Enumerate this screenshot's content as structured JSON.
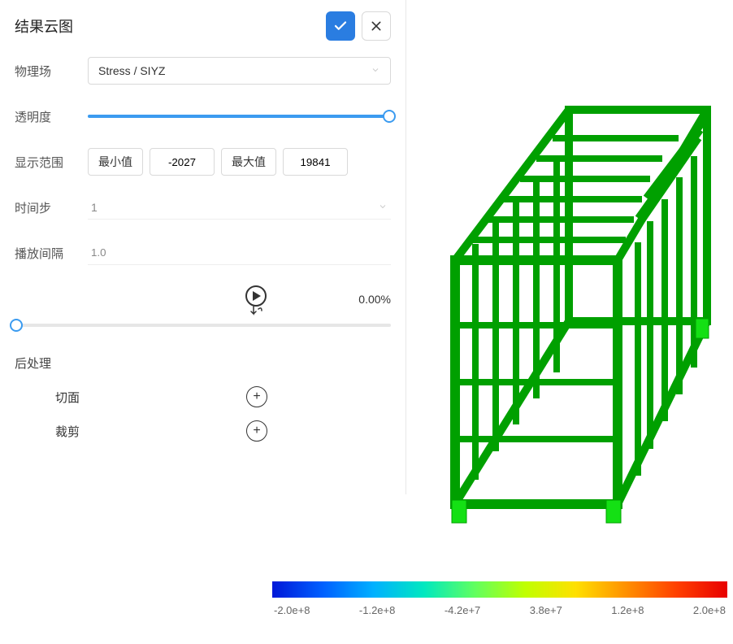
{
  "panel": {
    "title": "结果云图",
    "physicsLabel": "物理场",
    "physicsValue": "Stress / SIYZ",
    "opacityLabel": "透明度",
    "rangeLabel": "显示范围",
    "minLabel": "最小值",
    "minValue": "-2027",
    "maxLabel": "最大值",
    "maxValue": "19841",
    "timestepLabel": "时间步",
    "timestepValue": "1",
    "intervalLabel": "播放间隔",
    "intervalValue": "1.0",
    "progress": "0.00%",
    "postLabel": "后处理",
    "sectionLabel": "切面",
    "clipLabel": "裁剪"
  },
  "legend": {
    "ticks": [
      "-2.0e+8",
      "-1.2e+8",
      "-4.2e+7",
      "3.8e+7",
      "1.2e+8",
      "2.0e+8"
    ]
  }
}
